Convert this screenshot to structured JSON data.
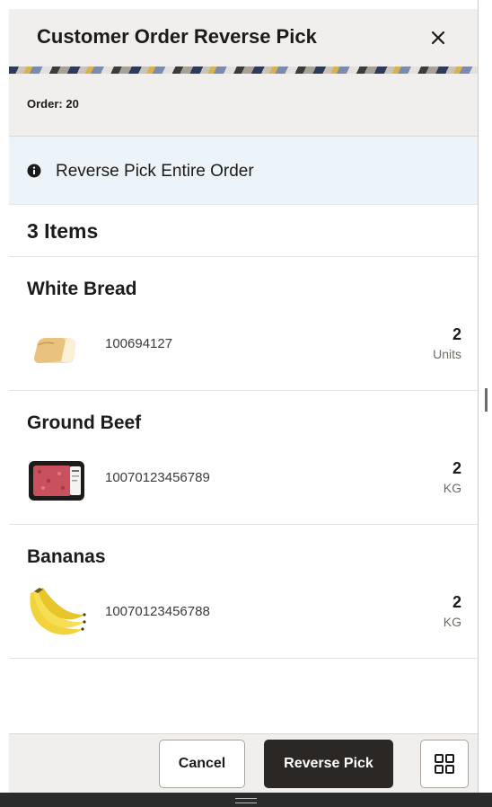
{
  "dialog": {
    "title": "Customer Order Reverse Pick",
    "order_label": "Order: 20",
    "notice": "Reverse Pick Entire Order",
    "items_count": "3 Items"
  },
  "items": [
    {
      "name": "White Bread",
      "code": "100694127",
      "qty": "2",
      "unit": "Units",
      "thumb": "white-bread-image"
    },
    {
      "name": "Ground Beef",
      "code": "10070123456789",
      "qty": "2",
      "unit": "KG",
      "thumb": "ground-beef-image"
    },
    {
      "name": "Bananas",
      "code": "10070123456788",
      "qty": "2",
      "unit": "KG",
      "thumb": "bananas-image"
    }
  ],
  "footer": {
    "cancel_label": "Cancel",
    "reverse_pick_label": "Reverse Pick",
    "grid_icon": "grid-icon"
  },
  "colors": {
    "header_bg": "#f1efed",
    "notice_bg": "#edf4f9",
    "primary_button": "#2b2724"
  }
}
